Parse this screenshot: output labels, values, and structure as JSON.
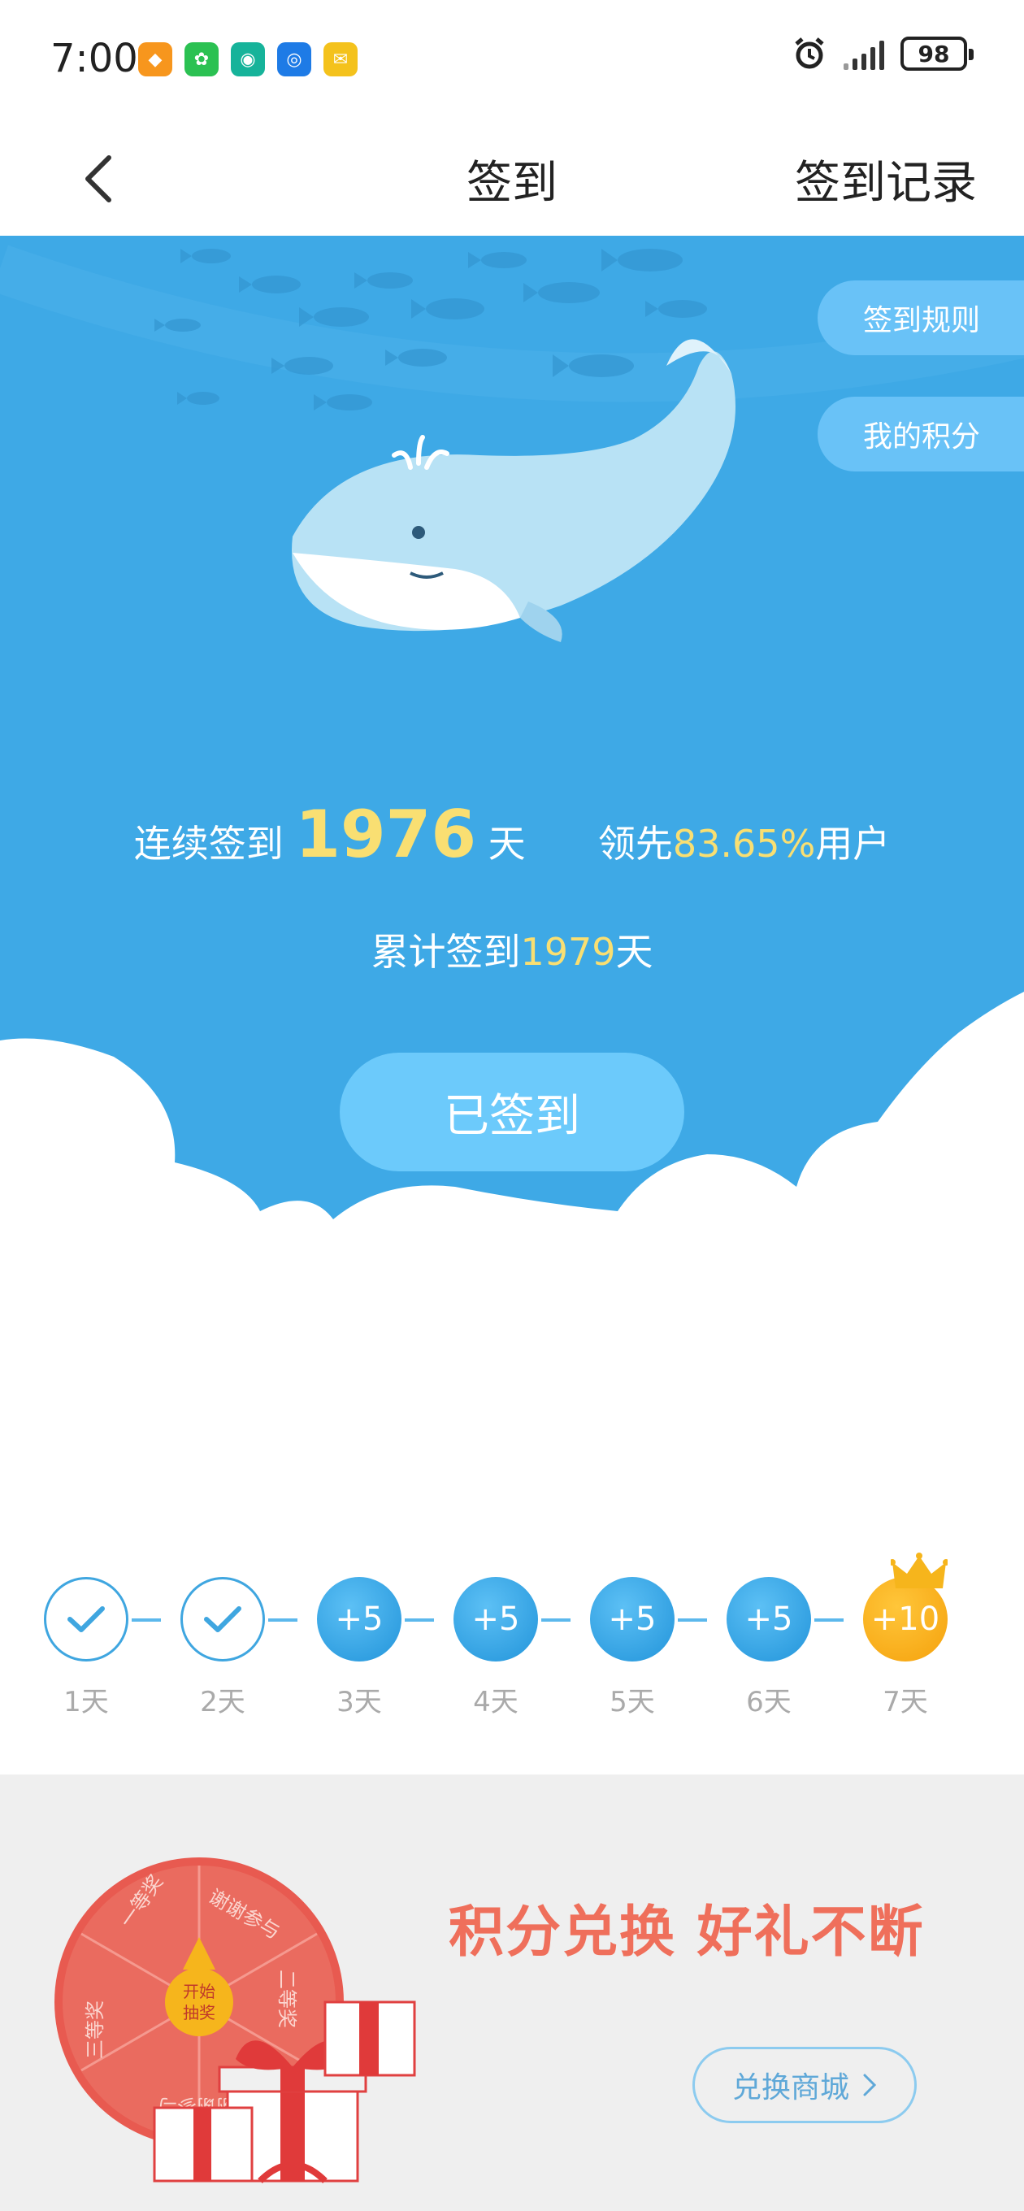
{
  "status_bar": {
    "time": "7:00",
    "battery": "98",
    "app_icons": [
      {
        "name": "app-orange-icon",
        "color": "#f7961d",
        "glyph": "◆"
      },
      {
        "name": "wechat-icon",
        "color": "#2bc152",
        "glyph": "✿"
      },
      {
        "name": "app-teal-icon",
        "color": "#16b39a",
        "glyph": "◉"
      },
      {
        "name": "app-blue-icon",
        "color": "#1e7be6",
        "glyph": "◎"
      },
      {
        "name": "mail-icon",
        "color": "#f4c21c",
        "glyph": "✉"
      }
    ]
  },
  "nav": {
    "title": "签到",
    "record": "签到记录"
  },
  "hero": {
    "rules_btn": "签到规则",
    "points_btn": "我的积分",
    "streak_prefix": "连续签到",
    "streak_days": "1976",
    "streak_unit": "天",
    "lead_prefix": "领先",
    "lead_percent": "83.65%",
    "lead_suffix": "用户",
    "total_prefix": "累计签到",
    "total_days": "1979",
    "total_unit": "天",
    "signed_btn": "已签到"
  },
  "week": [
    {
      "label": "1天",
      "reward": "",
      "state": "done"
    },
    {
      "label": "2天",
      "reward": "",
      "state": "done"
    },
    {
      "label": "3天",
      "reward": "+5",
      "state": "todo"
    },
    {
      "label": "4天",
      "reward": "+5",
      "state": "todo"
    },
    {
      "label": "5天",
      "reward": "+5",
      "state": "todo"
    },
    {
      "label": "6天",
      "reward": "+5",
      "state": "todo"
    },
    {
      "label": "7天",
      "reward": "+10",
      "state": "gold"
    }
  ],
  "promo": {
    "slogan": "积分兑换  好礼不断",
    "button": "兑换商城",
    "wheel_center": [
      "开始",
      "抽奖"
    ],
    "wheel_segments": [
      "一等奖",
      "谢谢参与",
      "二等奖",
      "谢谢参与",
      "三等奖",
      "二等奖"
    ]
  },
  "colors": {
    "hero_blue": "#3ea9e6",
    "highlight_yellow": "#f9df72",
    "promo_red": "#ef6f5b",
    "reward_blue": "#2294da",
    "reward_gold": "#f5a10c"
  }
}
